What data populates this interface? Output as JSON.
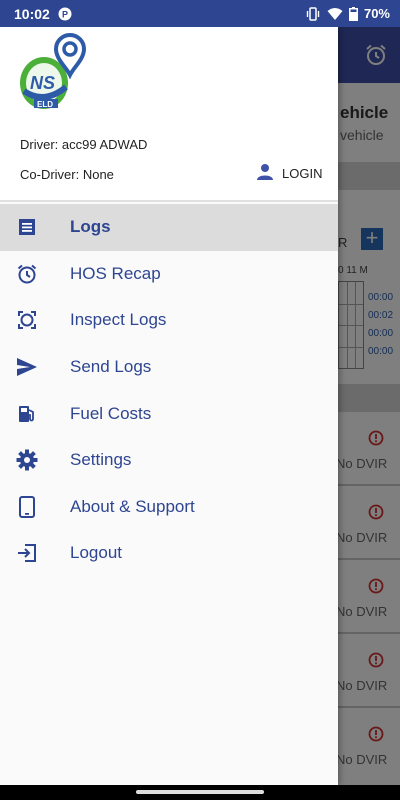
{
  "status_bar": {
    "time": "10:02",
    "battery": "70%",
    "icons": [
      "app-notification-icon",
      "vibrate-icon",
      "wifi-icon",
      "battery-icon"
    ]
  },
  "drawer": {
    "driver_text": "Driver: acc99 ADWAD",
    "codriver_text": "Co-Driver: None",
    "login_label": "LOGIN",
    "menu": [
      {
        "label": "Logs",
        "icon": "logs-icon",
        "active": true
      },
      {
        "label": "HOS Recap",
        "icon": "alarm-clock-icon",
        "active": false
      },
      {
        "label": "Inspect Logs",
        "icon": "inspect-icon",
        "active": false
      },
      {
        "label": "Send Logs",
        "icon": "send-icon",
        "active": false
      },
      {
        "label": "Fuel Costs",
        "icon": "fuel-icon",
        "active": false
      },
      {
        "label": "Settings",
        "icon": "gear-icon",
        "active": false
      },
      {
        "label": "About & Support",
        "icon": "phone-icon",
        "active": false
      },
      {
        "label": "Logout",
        "icon": "logout-icon",
        "active": false
      }
    ]
  },
  "background": {
    "title_partial": "ehicle",
    "subtitle_partial": "vehicle",
    "r_label": "R",
    "plus_label": "+",
    "hours_label": "0 11 M",
    "times": [
      "00:00",
      "00:02",
      "00:00",
      "00:00"
    ],
    "dvir_cards": [
      "No DVIR",
      "No DVIR",
      "No DVIR",
      "No DVIR",
      "No DVIR"
    ]
  },
  "colors": {
    "status_bar": "#2e4591",
    "toolbar": "#3f51a8",
    "menu_text": "#2e4591",
    "warning": "#d32f2f",
    "logo_green": "#4caf3a",
    "logo_blue": "#2e5ba8"
  }
}
